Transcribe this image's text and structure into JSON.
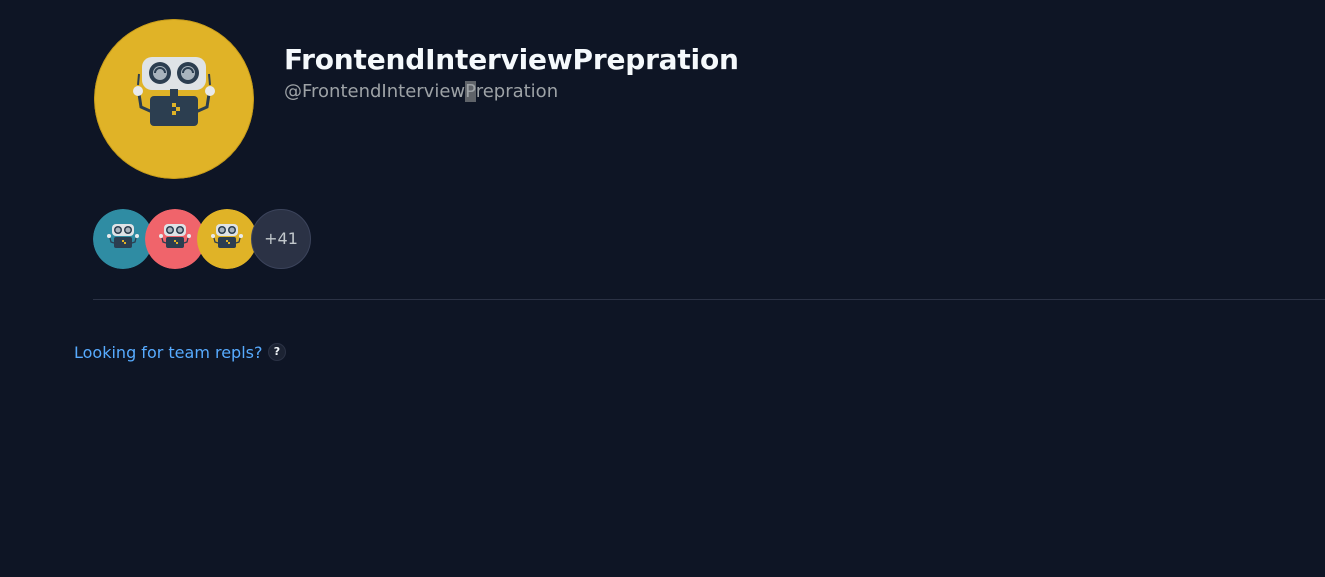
{
  "profile": {
    "name": "FrontendInterviewPrepration",
    "handle_before_caret": "@FrontendInterview",
    "handle_caret_char": "P",
    "handle_after_caret": "repration",
    "avatar_icon": "replit-robot-icon",
    "avatar_color": "#e0b327"
  },
  "members": {
    "avatars": [
      {
        "icon": "replit-robot-icon",
        "color": "#2f8ca3"
      },
      {
        "icon": "replit-robot-icon",
        "color": "#f0646b"
      },
      {
        "icon": "replit-robot-icon",
        "color": "#e0b327"
      }
    ],
    "more_count_label": "+41"
  },
  "team_repls": {
    "link_label": "Looking for team repls?",
    "help_icon_glyph": "?"
  },
  "colors": {
    "background": "#0e1525",
    "link": "#57abff",
    "name_text": "#f5f9fc",
    "handle_text": "#9da2a6"
  }
}
